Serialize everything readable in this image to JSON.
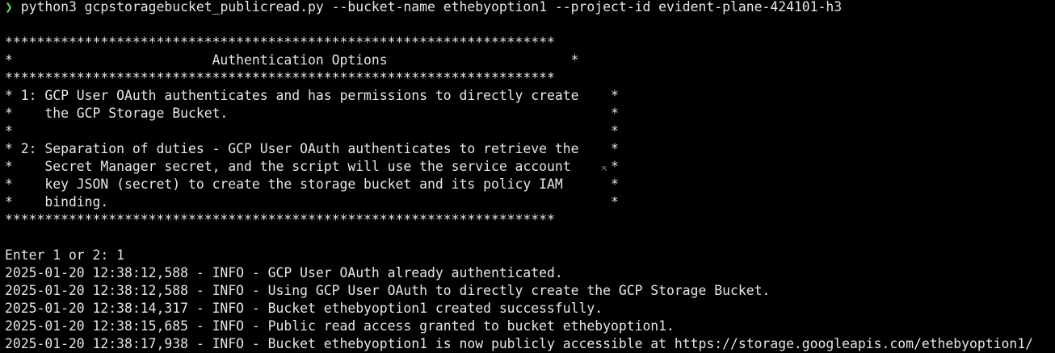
{
  "prompt": {
    "symbol": "❯",
    "command": " python3 gcpstoragebucket_publicread.py --bucket-name ethebyoption1 --project-id evident-plane-424101-h3"
  },
  "banner": {
    "border": "*********************************************************************",
    "title_line": "*                         Authentication Options                       *",
    "body": [
      "* 1: GCP User OAuth authenticates and has permissions to directly create    *",
      "*    the GCP Storage Bucket.                                                *",
      "*                                                                           *",
      "* 2: Separation of duties - GCP User OAuth authenticates to retrieve the    *",
      "*    Secret Manager secret, and the script will use the service account     *",
      "*    key JSON (secret) to create the storage bucket and its policy IAM      *",
      "*    binding.                                                               *"
    ]
  },
  "input_prompt": "Enter 1 or 2: 1",
  "logs": [
    "2025-01-20 12:38:12,588 - INFO - GCP User OAuth already authenticated.",
    "2025-01-20 12:38:12,588 - INFO - Using GCP User OAuth to directly create the GCP Storage Bucket.",
    "2025-01-20 12:38:14,317 - INFO - Bucket ethebyoption1 created successfully.",
    "2025-01-20 12:38:15,685 - INFO - Public read access granted to bucket ethebyoption1.",
    "2025-01-20 12:38:17,938 - INFO - Bucket ethebyoption1 is now publicly accessible at https://storage.googleapis.com/ethebyoption1/"
  ],
  "cursor_icon": "mouse-pointer-icon",
  "colors": {
    "background": "#000000",
    "text": "#e6e6e6",
    "prompt": "#5fd75f"
  }
}
